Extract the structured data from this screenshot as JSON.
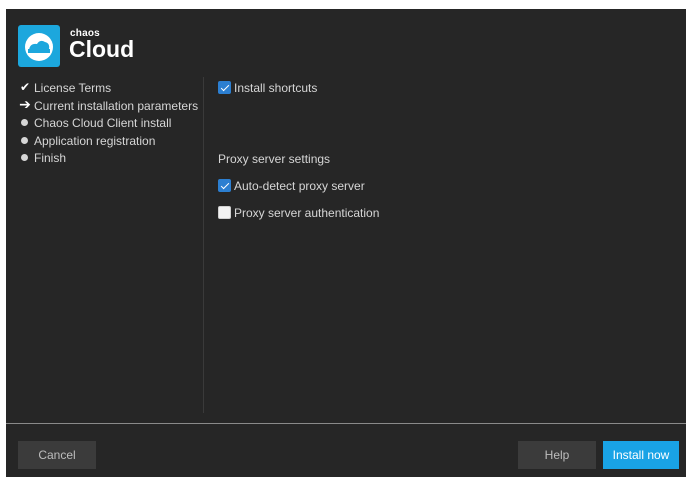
{
  "brand": {
    "small": "chaos",
    "big": "Cloud",
    "logo_icon": "chaos-cloud-logo-icon",
    "logo_color": "#1ca7dd"
  },
  "steps": [
    {
      "label": "License Terms",
      "state": "done",
      "icon": "checkmark-icon"
    },
    {
      "label": "Current installation parameters",
      "state": "current",
      "icon": "arrow-right-icon"
    },
    {
      "label": "Chaos Cloud Client install",
      "state": "pending",
      "icon": "bullet-icon"
    },
    {
      "label": "Application registration",
      "state": "pending",
      "icon": "bullet-icon"
    },
    {
      "label": "Finish",
      "state": "pending",
      "icon": "bullet-icon"
    }
  ],
  "options": {
    "install_shortcuts": {
      "label": "Install shortcuts",
      "checked": true
    }
  },
  "proxy": {
    "title": "Proxy server settings",
    "auto_detect": {
      "label": "Auto-detect proxy server",
      "checked": true
    },
    "authentication": {
      "label": "Proxy server authentication",
      "checked": false
    }
  },
  "footer": {
    "cancel_label": "Cancel",
    "help_label": "Help",
    "install_label": "Install now",
    "accent": "#19a3e6"
  }
}
